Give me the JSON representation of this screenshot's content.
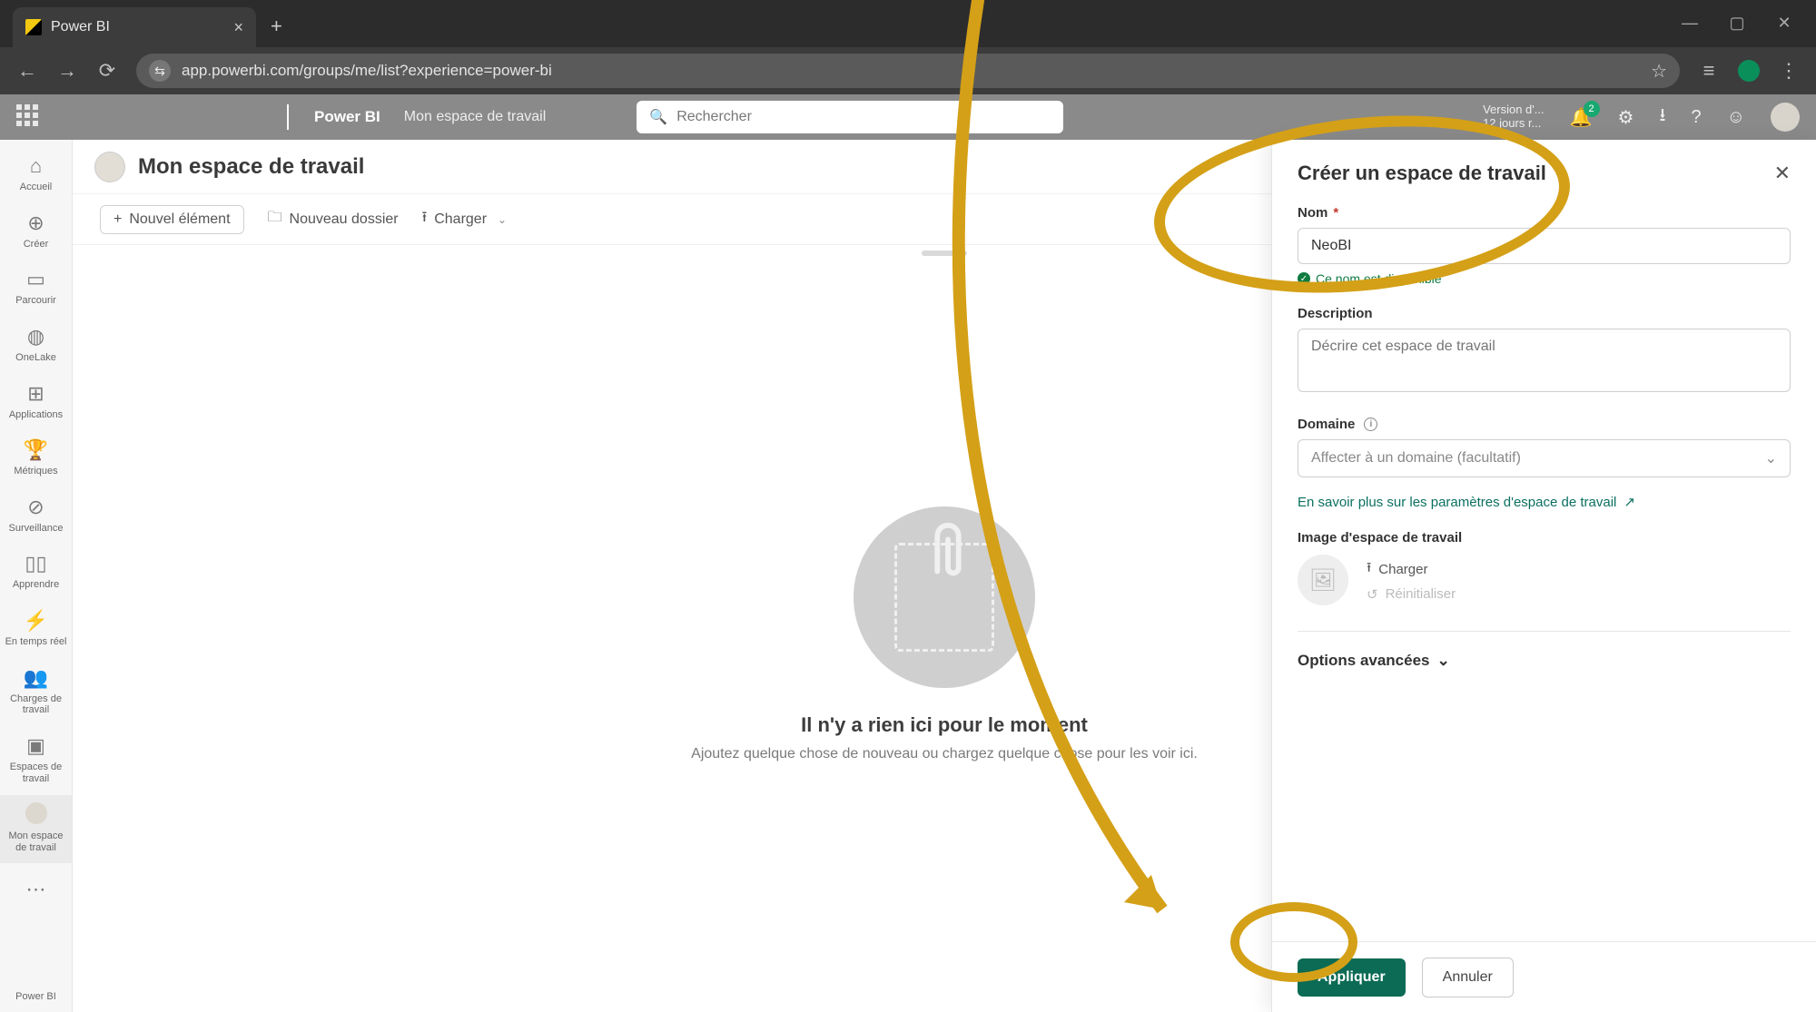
{
  "browser": {
    "tab_title": "Power BI",
    "url": "app.powerbi.com/groups/me/list?experience=power-bi"
  },
  "topbar": {
    "brand": "Power BI",
    "breadcrumb": "Mon espace de travail",
    "search_placeholder": "Rechercher",
    "trial_line1": "Version d'...",
    "trial_line2": "12 jours r...",
    "notif_count": "2"
  },
  "leftnav": {
    "items": [
      {
        "icon": "⌂",
        "label": "Accueil"
      },
      {
        "icon": "＋",
        "label": "Créer"
      },
      {
        "icon": "▭",
        "label": "Parcourir"
      },
      {
        "icon": "◯",
        "label": "OneLake"
      },
      {
        "icon": "⊞",
        "label": "Applications"
      },
      {
        "icon": "♀",
        "label": "Métriques"
      },
      {
        "icon": "⊘",
        "label": "Surveillance"
      },
      {
        "icon": "▭▯",
        "label": "Apprendre"
      },
      {
        "icon": "⚡",
        "label": "En temps réel"
      },
      {
        "icon": "⚭",
        "label": "Charges de travail"
      },
      {
        "icon": "▣",
        "label": "Espaces de travail"
      },
      {
        "icon": "avatar",
        "label": "Mon espace de travail"
      }
    ],
    "bottom_label": "Power BI"
  },
  "main": {
    "title": "Mon espace de travail",
    "toolbar": {
      "new_item": "Nouvel élément",
      "new_folder": "Nouveau dossier",
      "upload": "Charger"
    },
    "empty": {
      "heading": "Il n'y a rien ici pour le moment",
      "sub": "Ajoutez quelque chose de nouveau ou chargez quelque chose pour les voir ici."
    }
  },
  "panel": {
    "title": "Créer un espace de travail",
    "name_label": "Nom",
    "name_value": "NeoBI",
    "available": "Ce nom est disponible",
    "desc_label": "Description",
    "desc_placeholder": "Décrire cet espace de travail",
    "domain_label": "Domaine",
    "domain_placeholder": "Affecter à un domaine (facultatif)",
    "settings_link": "En savoir plus sur les paramètres d'espace de travail",
    "image_label": "Image d'espace de travail",
    "image_upload": "Charger",
    "image_reset": "Réinitialiser",
    "advanced": "Options avancées",
    "apply": "Appliquer",
    "cancel": "Annuler"
  }
}
